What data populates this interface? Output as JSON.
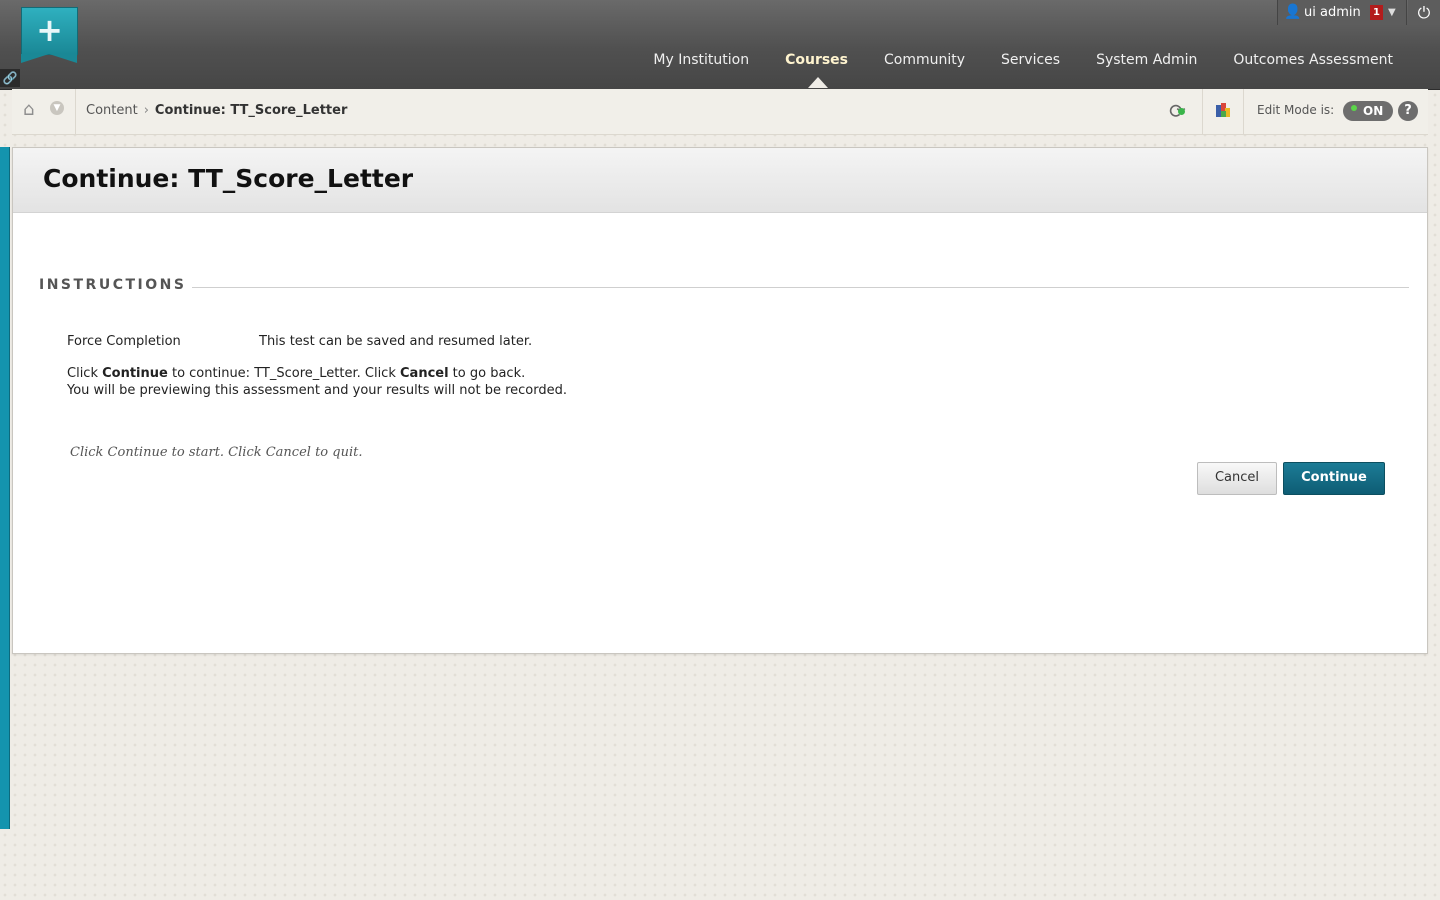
{
  "header": {
    "logo_glyph": "+",
    "user_name": "ui admin",
    "notification_count": "1",
    "nav": [
      {
        "label": "My Institution",
        "active": false
      },
      {
        "label": "Courses",
        "active": true
      },
      {
        "label": "Community",
        "active": false
      },
      {
        "label": "Services",
        "active": false
      },
      {
        "label": "System Admin",
        "active": false
      },
      {
        "label": "Outcomes Assessment",
        "active": false
      }
    ]
  },
  "breadcrumb": {
    "items": [
      "Content",
      "Continue: TT_Score_Letter"
    ],
    "separator": "›"
  },
  "edit_mode": {
    "label": "Edit Mode is:",
    "state": "ON",
    "help_glyph": "?"
  },
  "page": {
    "title": "Continue: TT_Score_Letter",
    "section_title": "INSTRUCTIONS",
    "force_completion_label": "Force Completion",
    "force_completion_value": "This test can be saved and resumed later.",
    "instruction_line1": {
      "click1": "Click ",
      "continue_word": "Continue",
      "mid": " to continue: TT_Score_Letter. Click ",
      "cancel_word": "Cancel",
      "end": " to go back."
    },
    "instruction_line2": "You will be previewing this assessment and your results will not be recorded.",
    "hint": "Click Continue to start. Click Cancel to quit.",
    "cancel_label": "Cancel",
    "continue_label": "Continue"
  },
  "colors": {
    "accent": "#1494ae",
    "primary_button": "#0e5d74",
    "nav_active": "#fff4cf",
    "notification_badge": "#b31c1c",
    "edit_mode_led": "#5bd64a"
  },
  "icons": [
    "logo-plus-icon",
    "link-icon",
    "user-icon",
    "caret-down-icon",
    "power-icon",
    "home-icon",
    "chevron-down-icon",
    "student-preview-icon",
    "color-palette-icon",
    "help-icon"
  ]
}
